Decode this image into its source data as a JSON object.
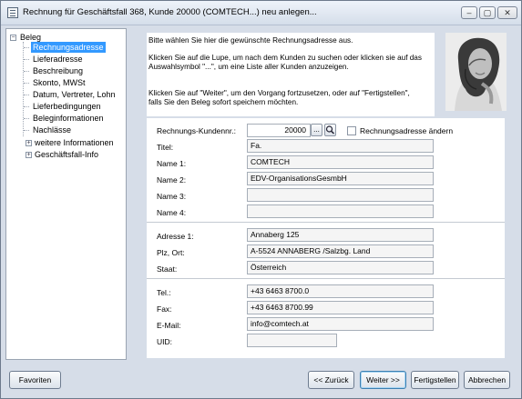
{
  "window": {
    "title": "Rechnung für Geschäftsfall 368, Kunde 20000 (COMTECH...) neu anlegen...",
    "minimize_label": "–",
    "maximize_label": "▢",
    "close_label": "✕"
  },
  "tree": {
    "root": "Beleg",
    "items": [
      "Rechnungsadresse",
      "Lieferadresse",
      "Beschreibung",
      "Skonto, MWSt",
      "Datum, Vertreter, Lohn",
      "Lieferbedingungen",
      "Beleginformationen",
      "Nachlässe"
    ],
    "more": "weitere Informationen",
    "case_info": "Geschäftsfall-Info"
  },
  "info": {
    "line1": "Bitte wählen Sie hier die gewünschte Rechnungsadresse aus.",
    "line2a": "Klicken Sie auf die Lupe, um nach dem Kunden zu suchen oder klicken sie auf das",
    "line2b": "Auswahlsymbol \"...\", um eine Liste aller Kunden anzuzeigen.",
    "line3a": "Klicken Sie auf \"Weiter\", um den Vorgang fortzusetzen, oder auf \"Fertigstellen\",",
    "line3b": "falls Sie den Beleg sofort speichern möchten."
  },
  "form": {
    "customer_no_label": "Rechnungs-Kundennr.:",
    "customer_no_value": "20000",
    "browse_label": "...",
    "change_address_label": "Rechnungsadresse ändern",
    "titel_label": "Titel:",
    "titel_value": "Fa.",
    "name1_label": "Name 1:",
    "name1_value": "COMTECH",
    "name2_label": "Name 2:",
    "name2_value": "EDV-OrganisationsGesmbH",
    "name3_label": "Name 3:",
    "name3_value": "",
    "name4_label": "Name 4:",
    "name4_value": "",
    "adresse_label": "Adresse 1:",
    "adresse_value": "Annaberg 125",
    "plz_label": "Plz, Ort:",
    "plz_value": "A-5524 ANNABERG /Salzbg. Land",
    "staat_label": "Staat:",
    "staat_value": "Österreich",
    "tel_label": "Tel.:",
    "tel_value": "+43 6463 8700.0",
    "fax_label": "Fax:",
    "fax_value": "+43 6463 8700.99",
    "email_label": "E-Mail:",
    "email_value": "info@comtech.at",
    "uid_label": "UID:",
    "uid_value": ""
  },
  "buttons": {
    "favoriten": "Favoriten",
    "zurueck": "<< Zurück",
    "weiter": "Weiter >>",
    "fertigstellen": "Fertigstellen",
    "abbrechen": "Abbrechen"
  },
  "icons": {
    "window": "window-list-icon",
    "search": "magnifier-icon",
    "tree_expand": "tree-expand-icon",
    "tree_collapse": "tree-collapse-icon"
  }
}
